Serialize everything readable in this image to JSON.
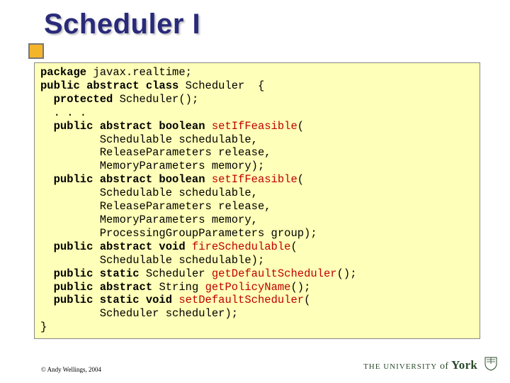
{
  "title": "Scheduler I",
  "code": {
    "l1a": "package",
    "l1b": " javax.realtime;",
    "l2a": "public abstract class",
    "l2b": " Scheduler  {",
    "l3a": "  protected",
    "l3b": " Scheduler();",
    "l4": "  . . .",
    "l5a": "  public abstract boolean ",
    "l5m": "setIfFeasible",
    "l5b": "(",
    "l6": "         Schedulable schedulable,",
    "l7": "         ReleaseParameters release,",
    "l8": "         MemoryParameters memory);",
    "l9a": "  public abstract boolean ",
    "l9m": "setIfFeasible",
    "l9b": "(",
    "l10": "         Schedulable schedulable,",
    "l11": "         ReleaseParameters release,",
    "l12": "         MemoryParameters memory,",
    "l13": "         ProcessingGroupParameters group);",
    "l14a": "  public abstract void ",
    "l14m": "fireSchedulable",
    "l14b": "(",
    "l15": "         Schedulable schedulable);",
    "l16a": "  public static",
    "l16b": " Scheduler ",
    "l16m": "getDefaultScheduler",
    "l16c": "();",
    "l17a": "  public abstract",
    "l17b": " String ",
    "l17m": "getPolicyName",
    "l17c": "();",
    "l18a": "  public static void ",
    "l18m": "setDefaultScheduler",
    "l18b": "(",
    "l19": "         Scheduler scheduler);",
    "l20": "}"
  },
  "copyright": "© Andy Wellings, 2004",
  "logo": {
    "small": "THE UNIVERSITY",
    "of": " of ",
    "york": "York"
  }
}
